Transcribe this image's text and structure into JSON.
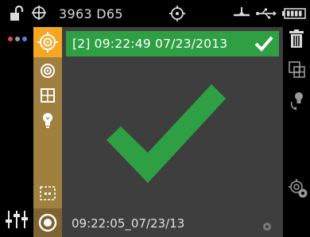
{
  "status_bar": {
    "device_label": "3963 D65",
    "icons": [
      "lock-open-icon",
      "crosshair-icon",
      "target-icon",
      "tripod-icon",
      "usb-icon",
      "battery-icon"
    ]
  },
  "left_bar": {
    "dot_colors": [
      "#e04848",
      "#9a9a9a",
      "#5b7fd0"
    ],
    "icons": [
      "color-dots-icon",
      "sliders-icon"
    ]
  },
  "tool_bar": {
    "icons": [
      "target-mode-icon",
      "concentric-circles-icon",
      "grid-icon",
      "bulb-icon",
      "dashed-box-icon",
      "measure-button-icon"
    ]
  },
  "main": {
    "header_text": "[2] 09:22:49 07/23/2013",
    "footer_text": "09:22:05_07/23/13"
  },
  "right_bar": {
    "icons": [
      "trash-icon",
      "compare-icon",
      "lightbulb-cycle-icon",
      "target-settings-icon"
    ]
  },
  "colors": {
    "accent_orange": "#f5a623",
    "toolbar_gold": "#a0803f",
    "success_green": "#2ea043",
    "panel_gray": "#3e3e3e"
  }
}
